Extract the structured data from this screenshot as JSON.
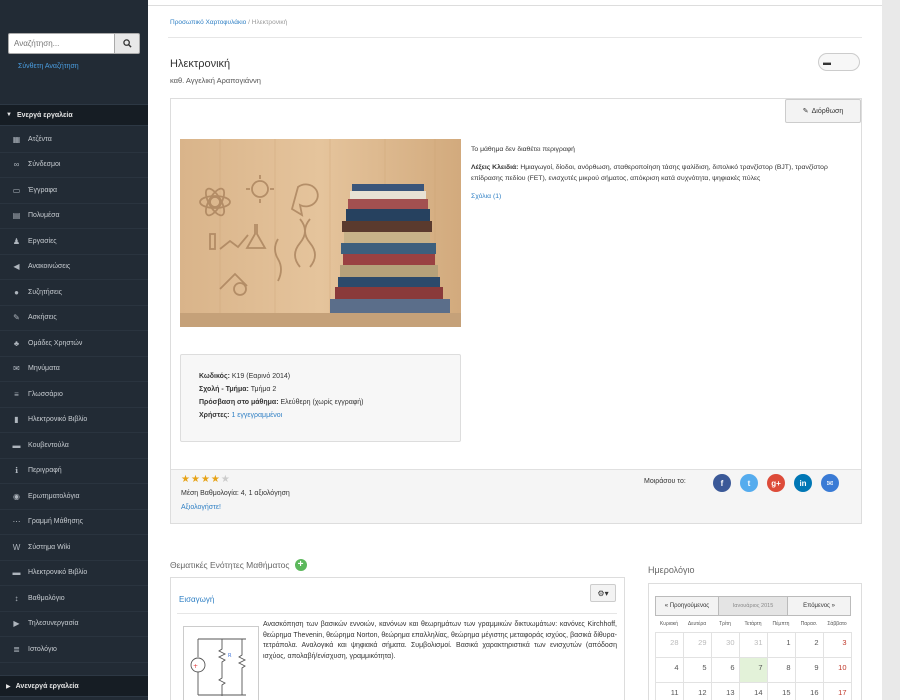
{
  "sidebar": {
    "search_placeholder": "Αναζήτηση...",
    "advanced_search": "Σύνθετη Αναζήτηση",
    "active_tools_header": "Ενεργά εργαλεία",
    "inactive_tools_header": "Ανενεργά εργαλεία",
    "items": [
      {
        "label": "Ατζέντα",
        "icon": "calendar-icon"
      },
      {
        "label": "Σύνδεσμοι",
        "icon": "link-icon"
      },
      {
        "label": "Έγγραφα",
        "icon": "folder-icon"
      },
      {
        "label": "Πολυμέσα",
        "icon": "film-icon"
      },
      {
        "label": "Εργασίες",
        "icon": "user-icon"
      },
      {
        "label": "Ανακοινώσεις",
        "icon": "bullhorn-icon"
      },
      {
        "label": "Συζητήσεις",
        "icon": "comments-icon"
      },
      {
        "label": "Ασκήσεις",
        "icon": "edit-icon"
      },
      {
        "label": "Ομάδες Χρηστών",
        "icon": "users-icon"
      },
      {
        "label": "Μηνύματα",
        "icon": "envelope-icon"
      },
      {
        "label": "Γλωσσάριο",
        "icon": "list-icon"
      },
      {
        "label": "Ηλεκτρονικό Βιβλίο",
        "icon": "book-icon"
      },
      {
        "label": "Κουβεντούλα",
        "icon": "chat-icon"
      },
      {
        "label": "Περιγραφή",
        "icon": "info-icon"
      },
      {
        "label": "Ερωτηματολόγια",
        "icon": "question-icon"
      },
      {
        "label": "Γραμμή Μάθησης",
        "icon": "route-icon"
      },
      {
        "label": "Σύστημα Wiki",
        "icon": "wiki-icon"
      },
      {
        "label": "Ηλεκτρονικό Βιβλίο",
        "icon": "journal-icon"
      },
      {
        "label": "Βαθμολόγιο",
        "icon": "grades-icon"
      },
      {
        "label": "Τηλεσυνεργασία",
        "icon": "video-icon"
      },
      {
        "label": "Ιστολόγιο",
        "icon": "blog-icon"
      }
    ]
  },
  "breadcrumb": {
    "home": "Προσωπικό Χαρτοφυλάκιο",
    "separator": "/",
    "current": "Ηλεκτρονική"
  },
  "course": {
    "title": "Ηλεκτρονική",
    "professor": "καθ. Αγγελική Αραπογιάννη",
    "edit_label": "Διόρθωση",
    "no_description": "Το μάθημα δεν διαθέτει περιγραφή",
    "keywords_label": "Λέξεις Κλειδιά:",
    "keywords": "Ημιαγωγοί, δίοδοι, ανόρθωση, σταθεροποίηση τάσης ψαλίδιση, διπολικό τρανζίστορ (BJT), τρανζίστορ επίδρασης πεδίου (FET), ενισχυτές μικρού σήματος, απόκριση κατά συχνότητα, ψηφιακές πύλες",
    "comments_link": "Σχόλια (1)",
    "info": {
      "code_label": "Κωδικός:",
      "code_value": "K19 (Εαρινό 2014)",
      "school_label": "Σχολή - Τμήμα:",
      "school_value": "Τμήμα 2",
      "access_label": "Πρόσβαση στο μάθημα:",
      "access_value": "Ελεύθερη (χωρίς εγγραφή)",
      "users_label": "Χρήστες:",
      "users_value": "1 εγγεγραμμένοι"
    },
    "rating": {
      "value": 4,
      "max": 5,
      "text": "Μέση Βαθμολογία: 4, 1 αξιολόγηση",
      "rate_link": "Αξιολογήστε!",
      "star_color": "#e7a317"
    },
    "share": {
      "label": "Μοιράσου το:",
      "icons": [
        {
          "name": "facebook-icon",
          "glyph": "f",
          "color": "#3b5998"
        },
        {
          "name": "twitter-icon",
          "glyph": "t",
          "color": "#55acee"
        },
        {
          "name": "google-plus-icon",
          "glyph": "g+",
          "color": "#dd4b39"
        },
        {
          "name": "linkedin-icon",
          "glyph": "in",
          "color": "#0077b5"
        },
        {
          "name": "email-icon",
          "glyph": "✉",
          "color": "#3a7bd5"
        }
      ]
    }
  },
  "units": {
    "title": "Θεματικές Ενότητες Μαθήματος",
    "unit_title": "Εισαγωγή",
    "unit_text": "Ανασκόπηση των βασικών εννοιών, κανόνων και θεωρημάτων των γραμμικών δικτυωμάτων: κανόνες Kirchhoff, θεώρημα Thevenin, θεώρημα Norton, θεώρημα επαλληλίας, θεώρημα μέγιστης μεταφοράς ισχύος, βασικά δίθυρα-τετράπολα. Αναλογικά και ψηφιακά σήματα. Συμβολισμοί. Βασικά χαρακτηριστικά των ενισχυτών (απόδοση ισχύος, απολαβή/ενίσχυση, γραμμικότητα)."
  },
  "calendar": {
    "title": "Ημερολόγιο",
    "prev_label": "« Προηγούμενος",
    "next_label": "Επόμενος »",
    "month_label": "Ιανουάριος 2015",
    "weekdays": [
      "Κυριακή",
      "Δευτέρα",
      "Τρίτη",
      "Τετάρτη",
      "Πέμπτη",
      "Παρασ.",
      "Σάββατο"
    ],
    "rows": [
      [
        "28",
        "29",
        "30",
        "31",
        "1",
        "2",
        "3"
      ],
      [
        "4",
        "5",
        "6",
        "7",
        "8",
        "9",
        "10"
      ],
      [
        "11",
        "12",
        "13",
        "14",
        "15",
        "16",
        "17"
      ]
    ]
  }
}
